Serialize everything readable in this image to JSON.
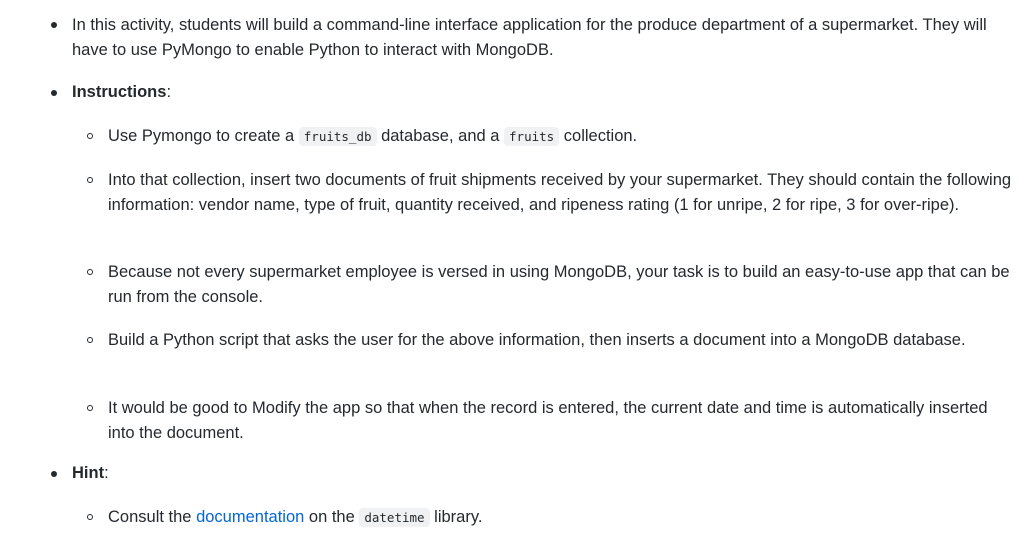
{
  "intro": {
    "text": "In this activity, students will build a command-line interface application for the produce department of a supermarket. They will have to use PyMongo to enable Python to interact with MongoDB."
  },
  "instructions": {
    "heading": "Instructions",
    "colon": ":",
    "items": [
      {
        "before": "Use Pymongo to create a ",
        "code1": "fruits_db",
        "middle": " database, and a ",
        "code2": "fruits",
        "after": " collection."
      },
      {
        "text": "Into that collection, insert two documents of fruit shipments received by your supermarket. They should contain the following information: vendor name, type of fruit, quantity received, and ripeness rating (1 for unripe, 2 for ripe, 3 for over-ripe)."
      },
      {
        "text": "Because not every supermarket employee is versed in using MongoDB, your task is to build an easy-to-use app that can be run from the console."
      },
      {
        "text": "Build a Python script that asks the user for the above information, then inserts a document into a MongoDB database."
      },
      {
        "text": "It would be good to Modify the app so that when the record is entered, the current date and time is automatically inserted into the document."
      }
    ]
  },
  "hint": {
    "heading": "Hint",
    "colon": ":",
    "items": [
      {
        "before": "Consult the ",
        "link": "documentation",
        "middle": " on the ",
        "code": "datetime",
        "after": " library."
      }
    ]
  },
  "colors": {
    "text": "#24292e",
    "link": "#0366d6",
    "code_bg": "#f0f1f2"
  }
}
